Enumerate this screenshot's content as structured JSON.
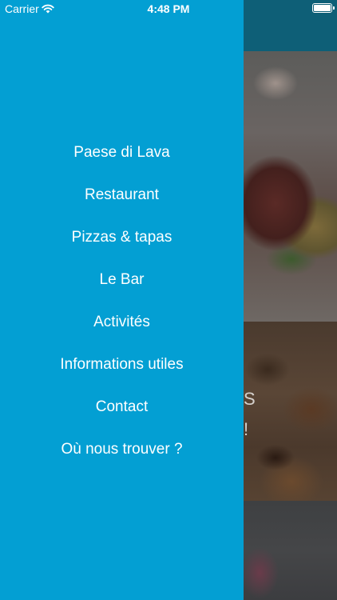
{
  "status_bar": {
    "carrier": "Carrier",
    "time": "4:48 PM",
    "wifi_icon": "wifi-icon",
    "battery_icon": "battery-icon",
    "battery_level": 1.0
  },
  "colors": {
    "drawer_background": "#039fd3",
    "navbar_background": "#0e5f77",
    "menu_text": "#ffffff"
  },
  "drawer": {
    "items": [
      {
        "label": "Paese di Lava"
      },
      {
        "label": "Restaurant"
      },
      {
        "label": "Pizzas & tapas"
      },
      {
        "label": "Le Bar"
      },
      {
        "label": "Activités"
      },
      {
        "label": "Informations utiles"
      },
      {
        "label": "Contact"
      },
      {
        "label": "Où nous trouver ?"
      }
    ]
  },
  "background": {
    "card_partial_text_1": "S",
    "card_partial_text_2": "!"
  }
}
